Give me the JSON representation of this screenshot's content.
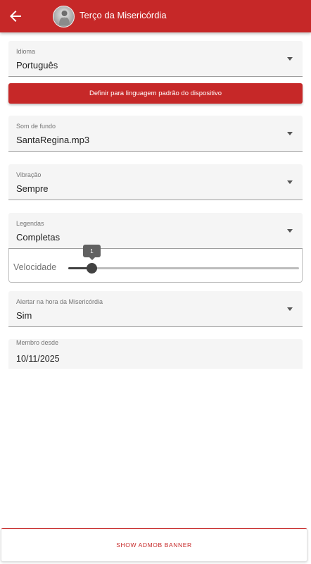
{
  "app": {
    "title": "Terço da Misericórdia"
  },
  "settings": {
    "language": {
      "label": "Idioma",
      "value": "Português"
    },
    "default_language_button": "Definir para linguagem padrão do dispositivo",
    "background_sound": {
      "label": "Som de fundo",
      "value": "SantaRegina.mp3"
    },
    "vibration": {
      "label": "Vibração",
      "value": "Sempre"
    },
    "subtitles": {
      "label": "Legendas",
      "value": "Completas"
    },
    "speed": {
      "label": "Velocidade",
      "value": "1"
    },
    "mercy_hour_alert": {
      "label": "Alertar na hora da Misericórdia",
      "value": "Sim"
    },
    "member_since": {
      "label": "Membro desde",
      "value": "10/11/2025"
    }
  },
  "footer": {
    "admob_button": "SHOW ADMOB BANNER"
  },
  "colors": {
    "primary": "#c62828",
    "field_background": "#f5f5f5"
  },
  "icons": {
    "back": "arrow-left",
    "logo": "saint-portrait",
    "dropdown": "caret-down"
  }
}
